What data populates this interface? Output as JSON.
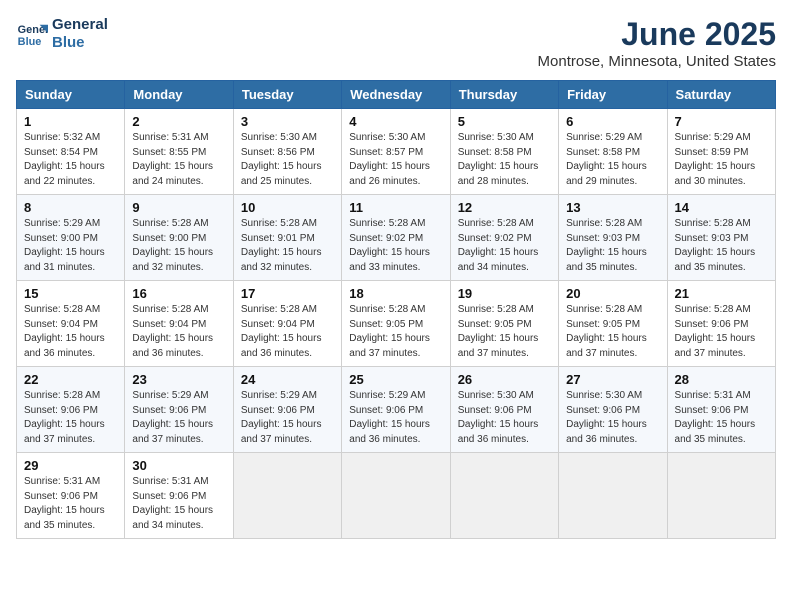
{
  "header": {
    "logo_line1": "General",
    "logo_line2": "Blue",
    "month": "June 2025",
    "location": "Montrose, Minnesota, United States"
  },
  "weekdays": [
    "Sunday",
    "Monday",
    "Tuesday",
    "Wednesday",
    "Thursday",
    "Friday",
    "Saturday"
  ],
  "weeks": [
    [
      {
        "day": "1",
        "sunrise": "Sunrise: 5:32 AM",
        "sunset": "Sunset: 8:54 PM",
        "daylight": "Daylight: 15 hours and 22 minutes."
      },
      {
        "day": "2",
        "sunrise": "Sunrise: 5:31 AM",
        "sunset": "Sunset: 8:55 PM",
        "daylight": "Daylight: 15 hours and 24 minutes."
      },
      {
        "day": "3",
        "sunrise": "Sunrise: 5:30 AM",
        "sunset": "Sunset: 8:56 PM",
        "daylight": "Daylight: 15 hours and 25 minutes."
      },
      {
        "day": "4",
        "sunrise": "Sunrise: 5:30 AM",
        "sunset": "Sunset: 8:57 PM",
        "daylight": "Daylight: 15 hours and 26 minutes."
      },
      {
        "day": "5",
        "sunrise": "Sunrise: 5:30 AM",
        "sunset": "Sunset: 8:58 PM",
        "daylight": "Daylight: 15 hours and 28 minutes."
      },
      {
        "day": "6",
        "sunrise": "Sunrise: 5:29 AM",
        "sunset": "Sunset: 8:58 PM",
        "daylight": "Daylight: 15 hours and 29 minutes."
      },
      {
        "day": "7",
        "sunrise": "Sunrise: 5:29 AM",
        "sunset": "Sunset: 8:59 PM",
        "daylight": "Daylight: 15 hours and 30 minutes."
      }
    ],
    [
      {
        "day": "8",
        "sunrise": "Sunrise: 5:29 AM",
        "sunset": "Sunset: 9:00 PM",
        "daylight": "Daylight: 15 hours and 31 minutes."
      },
      {
        "day": "9",
        "sunrise": "Sunrise: 5:28 AM",
        "sunset": "Sunset: 9:00 PM",
        "daylight": "Daylight: 15 hours and 32 minutes."
      },
      {
        "day": "10",
        "sunrise": "Sunrise: 5:28 AM",
        "sunset": "Sunset: 9:01 PM",
        "daylight": "Daylight: 15 hours and 32 minutes."
      },
      {
        "day": "11",
        "sunrise": "Sunrise: 5:28 AM",
        "sunset": "Sunset: 9:02 PM",
        "daylight": "Daylight: 15 hours and 33 minutes."
      },
      {
        "day": "12",
        "sunrise": "Sunrise: 5:28 AM",
        "sunset": "Sunset: 9:02 PM",
        "daylight": "Daylight: 15 hours and 34 minutes."
      },
      {
        "day": "13",
        "sunrise": "Sunrise: 5:28 AM",
        "sunset": "Sunset: 9:03 PM",
        "daylight": "Daylight: 15 hours and 35 minutes."
      },
      {
        "day": "14",
        "sunrise": "Sunrise: 5:28 AM",
        "sunset": "Sunset: 9:03 PM",
        "daylight": "Daylight: 15 hours and 35 minutes."
      }
    ],
    [
      {
        "day": "15",
        "sunrise": "Sunrise: 5:28 AM",
        "sunset": "Sunset: 9:04 PM",
        "daylight": "Daylight: 15 hours and 36 minutes."
      },
      {
        "day": "16",
        "sunrise": "Sunrise: 5:28 AM",
        "sunset": "Sunset: 9:04 PM",
        "daylight": "Daylight: 15 hours and 36 minutes."
      },
      {
        "day": "17",
        "sunrise": "Sunrise: 5:28 AM",
        "sunset": "Sunset: 9:04 PM",
        "daylight": "Daylight: 15 hours and 36 minutes."
      },
      {
        "day": "18",
        "sunrise": "Sunrise: 5:28 AM",
        "sunset": "Sunset: 9:05 PM",
        "daylight": "Daylight: 15 hours and 37 minutes."
      },
      {
        "day": "19",
        "sunrise": "Sunrise: 5:28 AM",
        "sunset": "Sunset: 9:05 PM",
        "daylight": "Daylight: 15 hours and 37 minutes."
      },
      {
        "day": "20",
        "sunrise": "Sunrise: 5:28 AM",
        "sunset": "Sunset: 9:05 PM",
        "daylight": "Daylight: 15 hours and 37 minutes."
      },
      {
        "day": "21",
        "sunrise": "Sunrise: 5:28 AM",
        "sunset": "Sunset: 9:06 PM",
        "daylight": "Daylight: 15 hours and 37 minutes."
      }
    ],
    [
      {
        "day": "22",
        "sunrise": "Sunrise: 5:28 AM",
        "sunset": "Sunset: 9:06 PM",
        "daylight": "Daylight: 15 hours and 37 minutes."
      },
      {
        "day": "23",
        "sunrise": "Sunrise: 5:29 AM",
        "sunset": "Sunset: 9:06 PM",
        "daylight": "Daylight: 15 hours and 37 minutes."
      },
      {
        "day": "24",
        "sunrise": "Sunrise: 5:29 AM",
        "sunset": "Sunset: 9:06 PM",
        "daylight": "Daylight: 15 hours and 37 minutes."
      },
      {
        "day": "25",
        "sunrise": "Sunrise: 5:29 AM",
        "sunset": "Sunset: 9:06 PM",
        "daylight": "Daylight: 15 hours and 36 minutes."
      },
      {
        "day": "26",
        "sunrise": "Sunrise: 5:30 AM",
        "sunset": "Sunset: 9:06 PM",
        "daylight": "Daylight: 15 hours and 36 minutes."
      },
      {
        "day": "27",
        "sunrise": "Sunrise: 5:30 AM",
        "sunset": "Sunset: 9:06 PM",
        "daylight": "Daylight: 15 hours and 36 minutes."
      },
      {
        "day": "28",
        "sunrise": "Sunrise: 5:31 AM",
        "sunset": "Sunset: 9:06 PM",
        "daylight": "Daylight: 15 hours and 35 minutes."
      }
    ],
    [
      {
        "day": "29",
        "sunrise": "Sunrise: 5:31 AM",
        "sunset": "Sunset: 9:06 PM",
        "daylight": "Daylight: 15 hours and 35 minutes."
      },
      {
        "day": "30",
        "sunrise": "Sunrise: 5:31 AM",
        "sunset": "Sunset: 9:06 PM",
        "daylight": "Daylight: 15 hours and 34 minutes."
      },
      null,
      null,
      null,
      null,
      null
    ]
  ]
}
